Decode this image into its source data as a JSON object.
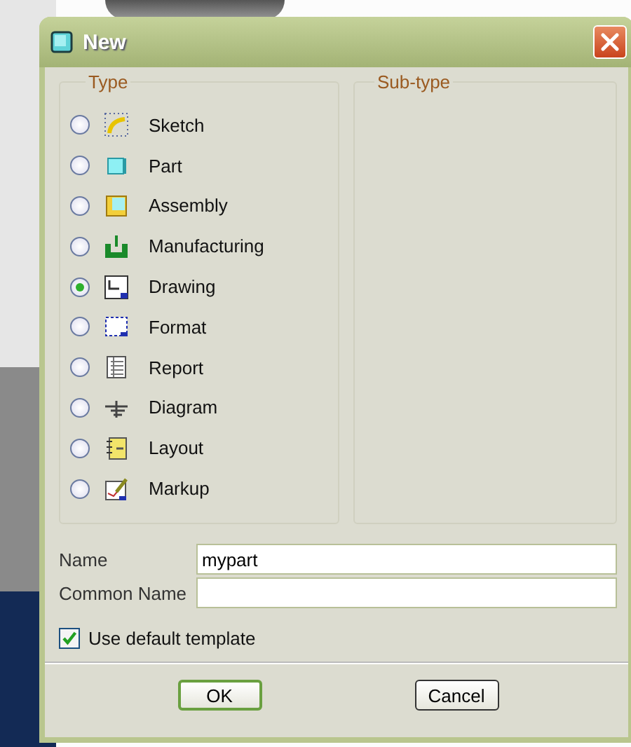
{
  "window": {
    "title": "New"
  },
  "type_group": {
    "label": "Type",
    "options": [
      {
        "label": "Sketch",
        "selected": false
      },
      {
        "label": "Part",
        "selected": false
      },
      {
        "label": "Assembly",
        "selected": false
      },
      {
        "label": "Manufacturing",
        "selected": false
      },
      {
        "label": "Drawing",
        "selected": true
      },
      {
        "label": "Format",
        "selected": false
      },
      {
        "label": "Report",
        "selected": false
      },
      {
        "label": "Diagram",
        "selected": false
      },
      {
        "label": "Layout",
        "selected": false
      },
      {
        "label": "Markup",
        "selected": false
      }
    ]
  },
  "subtype_group": {
    "label": "Sub-type"
  },
  "fields": [
    {
      "label": "Name",
      "value": "mypart"
    },
    {
      "label": "Common Name"
    }
  ],
  "use_default_template": {
    "label": "Use default template",
    "checked": true
  },
  "buttons": [
    {
      "label": "OK",
      "default": true
    },
    {
      "label": "Cancel",
      "default": false
    }
  ]
}
